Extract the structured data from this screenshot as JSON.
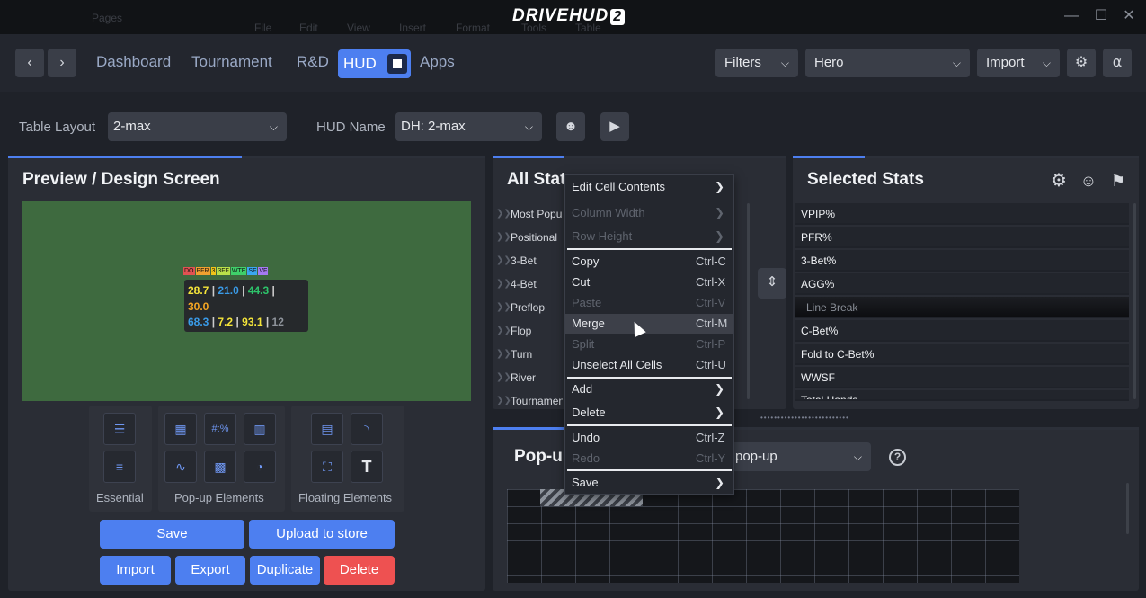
{
  "window": {
    "brand": "DRIVEHUD",
    "brand_suffix": "2",
    "ghost_menu": [
      "Pages",
      "File",
      "Edit",
      "View",
      "Insert",
      "Format",
      "Tools",
      "Table"
    ],
    "minimize": "—",
    "maximize": "☐",
    "close": "✕"
  },
  "nav": {
    "back": "‹",
    "forward": "›",
    "links": [
      "Dashboard",
      "Tournament",
      "R&D"
    ],
    "active_tab": "HUD",
    "apps": "Apps",
    "filters_label": "Filters",
    "player_value": "Hero",
    "import_label": "Import"
  },
  "toolbar": {
    "table_layout_label": "Table Layout",
    "table_layout_value": "2-max",
    "hud_name_label": "HUD Name",
    "hud_name_value": "DH: 2-max"
  },
  "preview": {
    "title": "Preview / Design Screen",
    "tags": [
      "DO",
      "PFR",
      "3",
      "3FF",
      "WTE",
      "SF",
      "VF"
    ],
    "tag_colors": [
      "#e05252",
      "#f0a030",
      "#f0c419",
      "#b9e04a",
      "#3fcf6a",
      "#3aa7f0",
      "#a47af0"
    ],
    "row1": [
      "28.7",
      "21.0",
      "44.3"
    ],
    "row2": [
      "30.0"
    ],
    "row3": [
      "68.3",
      "7.2",
      "93.1",
      "12"
    ],
    "sep": "|",
    "colors": {
      "yellow": "#f5e53a",
      "blue": "#3a9be8",
      "green": "#2dc36a",
      "orange": "#f5a623",
      "gray": "#8e939b"
    }
  },
  "tool_groups": [
    {
      "label": "Essential"
    },
    {
      "label": "Pop-up Elements"
    },
    {
      "label": "Floating Elements"
    }
  ],
  "tools": {
    "percent_glyph": "#:%",
    "text_glyph": "T"
  },
  "actions": {
    "save": "Save",
    "upload": "Upload to store",
    "import": "Import",
    "export": "Export",
    "duplicate": "Duplicate",
    "delete": "Delete"
  },
  "all_stats": {
    "title": "All Stats",
    "visible_title": "All Stat",
    "categories": [
      "Most Popular",
      "Positional",
      "3-Bet",
      "4-Bet",
      "Preflop",
      "Flop",
      "Turn",
      "River",
      "Tournament"
    ]
  },
  "selected_stats": {
    "title": "Selected Stats",
    "items": [
      "VPIP%",
      "PFR%",
      "3-Bet%",
      "AGG%",
      "Line Break",
      "C-Bet%",
      "Fold to C-Bet%",
      "WWSF",
      "Total Hands"
    ]
  },
  "popup": {
    "title": "Pop-up",
    "visible_title": "Pop-u",
    "select_value": "pop-up",
    "help": "?"
  },
  "context_menu": {
    "items": [
      {
        "label": "Edit Cell Contents",
        "shortcut": "",
        "submenu": true,
        "disabled": false
      },
      {
        "label": "Column Width",
        "shortcut": "",
        "submenu": true,
        "disabled": true
      },
      {
        "label": "Row Height",
        "shortcut": "",
        "submenu": true,
        "disabled": true
      },
      {
        "label": "Copy",
        "shortcut": "Ctrl-C",
        "submenu": false,
        "disabled": false
      },
      {
        "label": "Cut",
        "shortcut": "Ctrl-X",
        "submenu": false,
        "disabled": false
      },
      {
        "label": "Paste",
        "shortcut": "Ctrl-V",
        "submenu": false,
        "disabled": true
      },
      {
        "label": "Merge",
        "shortcut": "Ctrl-M",
        "submenu": false,
        "disabled": false,
        "highlighted": true
      },
      {
        "label": "Split",
        "shortcut": "Ctrl-P",
        "submenu": false,
        "disabled": true
      },
      {
        "label": "Unselect All Cells",
        "shortcut": "Ctrl-U",
        "submenu": false,
        "disabled": false
      },
      {
        "label": "Add",
        "shortcut": "",
        "submenu": true,
        "disabled": false
      },
      {
        "label": "Delete",
        "shortcut": "",
        "submenu": true,
        "disabled": false
      },
      {
        "label": "Undo",
        "shortcut": "Ctrl-Z",
        "submenu": false,
        "disabled": false
      },
      {
        "label": "Redo",
        "shortcut": "Ctrl-Y",
        "submenu": false,
        "disabled": true
      },
      {
        "label": "Save",
        "shortcut": "",
        "submenu": true,
        "disabled": false
      }
    ]
  },
  "theme": {
    "accent": "#4d7ff0",
    "danger": "#ee5151",
    "preview_bg": "#3e6a3f"
  }
}
